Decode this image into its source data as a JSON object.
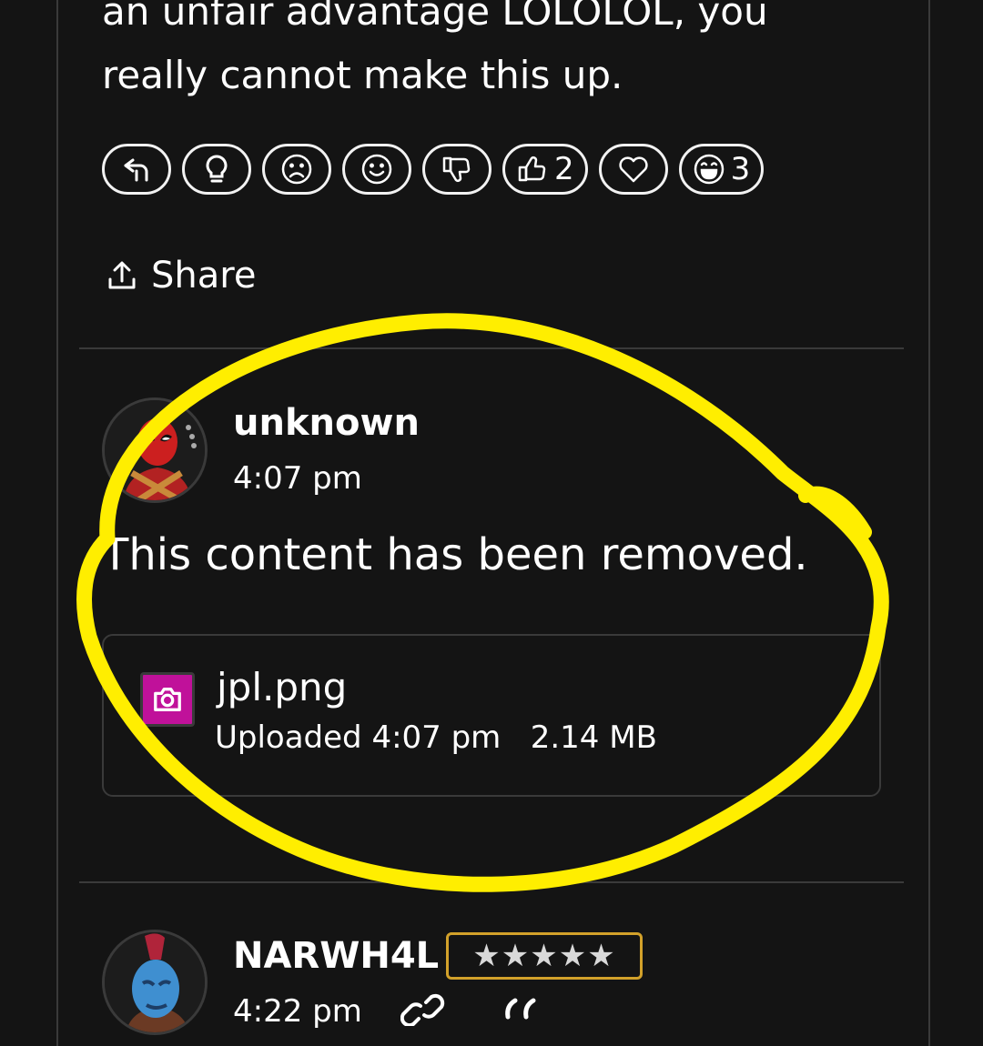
{
  "previous_post": {
    "text_line1": "an unfair advantage LOLOLOL, you",
    "text_line2": "really cannot make this up."
  },
  "reactions": [
    {
      "name": "reply-icon",
      "count": ""
    },
    {
      "name": "lightbulb-icon",
      "count": ""
    },
    {
      "name": "sad-face-icon",
      "count": ""
    },
    {
      "name": "smile-face-icon",
      "count": ""
    },
    {
      "name": "thumbs-down-icon",
      "count": ""
    },
    {
      "name": "thumbs-up-icon",
      "count": "2"
    },
    {
      "name": "heart-icon",
      "count": ""
    },
    {
      "name": "laugh-face-icon",
      "count": "3"
    }
  ],
  "share_label": "Share",
  "comment": {
    "username": "unknown",
    "time": "4:07 pm",
    "body": "This content has been removed.",
    "attachment": {
      "filename": "jpl.png",
      "meta": "Uploaded 4:07 pm   2.14 MB",
      "icon": "camera-icon"
    }
  },
  "next_comment": {
    "username": "NARWH4L",
    "rating": "★★★★★",
    "time": "4:22 pm",
    "icons": [
      "link-icon",
      "quote-icon"
    ]
  },
  "colors": {
    "background": "#141414",
    "highlight_circle": "#ffee00",
    "rating_border": "#d2a12a",
    "camera_icon_bg": "#c0119a"
  }
}
